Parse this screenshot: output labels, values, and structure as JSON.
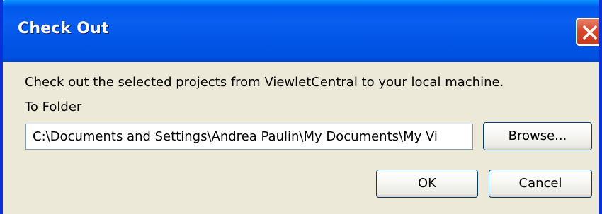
{
  "dialog": {
    "title": "Check Out",
    "description": "Check out the selected projects from ViewletCentral to your local machine.",
    "folder_label": "To Folder",
    "folder_path": "C:\\Documents and Settings\\Andrea Paulin\\My Documents\\My Vi",
    "browse_label": "Browse...",
    "ok_label": "OK",
    "cancel_label": "Cancel"
  },
  "icons": {
    "close": "close-icon"
  },
  "colors": {
    "titlebar": "#0054e3",
    "close_button": "#d7482a",
    "dialog_background": "#ece9d8"
  }
}
